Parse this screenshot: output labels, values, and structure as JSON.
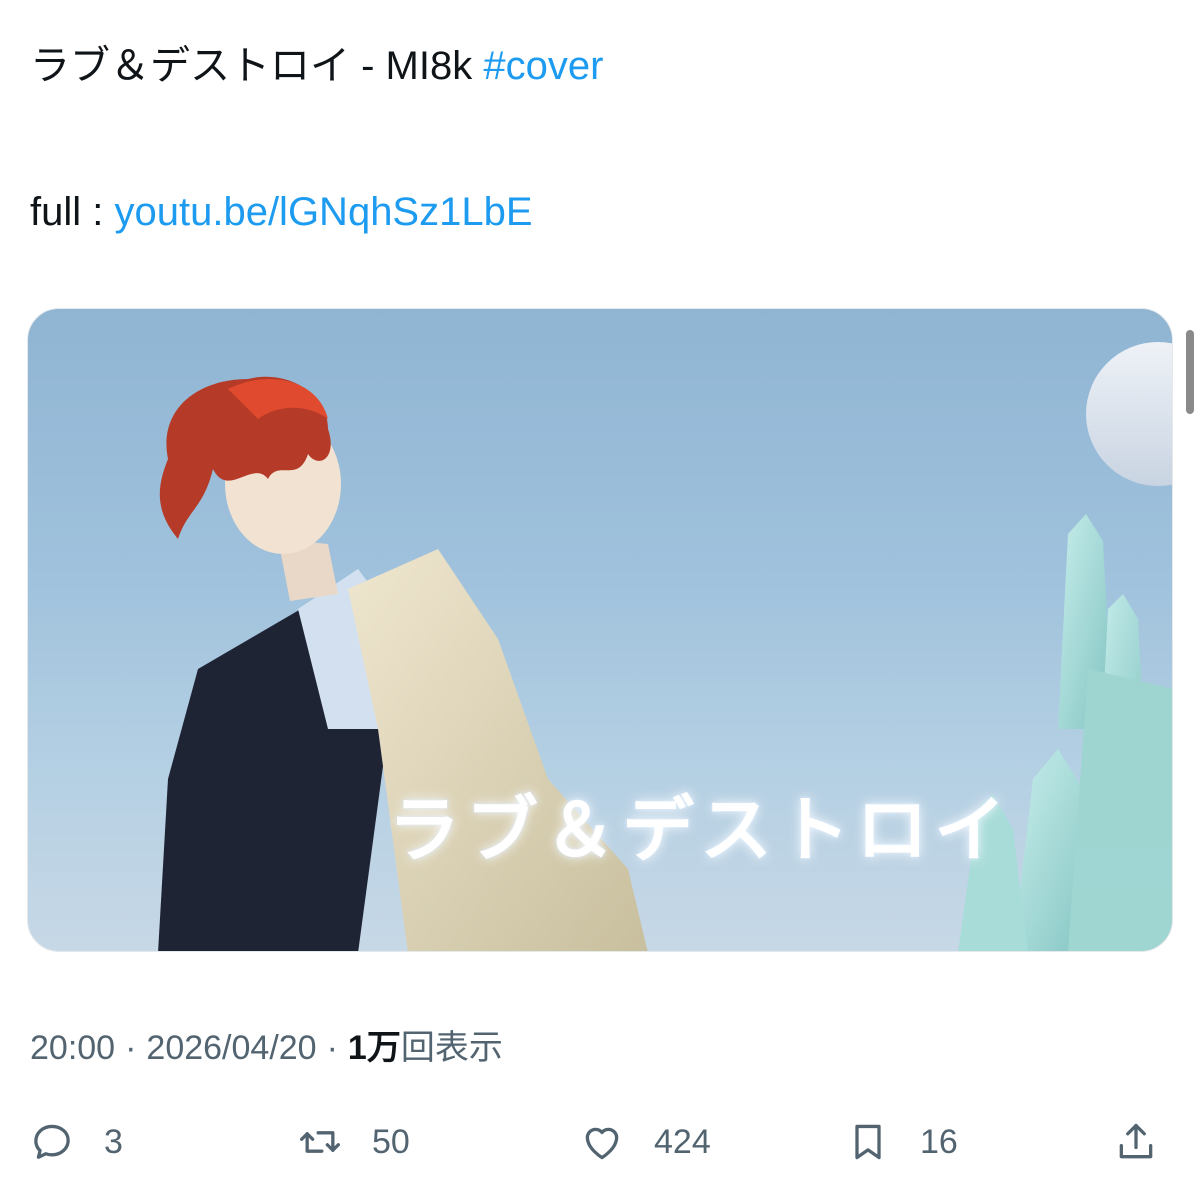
{
  "tweet": {
    "title_text": "ラブ＆デストロイ - MI8k ",
    "hashtag": "#cover",
    "full_label": "full : ",
    "link_text": "youtu.be/lGNqhSz1LbE"
  },
  "media": {
    "overlay_title": "ラブ＆デストロイ"
  },
  "meta": {
    "time": "20:00",
    "separator": "·",
    "date": "2026/04/20",
    "views_count": "1万",
    "views_label": "回表示"
  },
  "actions": {
    "reply_count": "3",
    "retweet_count": "50",
    "like_count": "424",
    "bookmark_count": "16"
  },
  "icons": {
    "reply": "reply-icon",
    "retweet": "retweet-icon",
    "like": "heart-icon",
    "bookmark": "bookmark-icon",
    "share": "share-icon"
  },
  "colors": {
    "link": "#1d9bf0",
    "secondary_text": "#536471",
    "primary_text": "#0f1419"
  }
}
